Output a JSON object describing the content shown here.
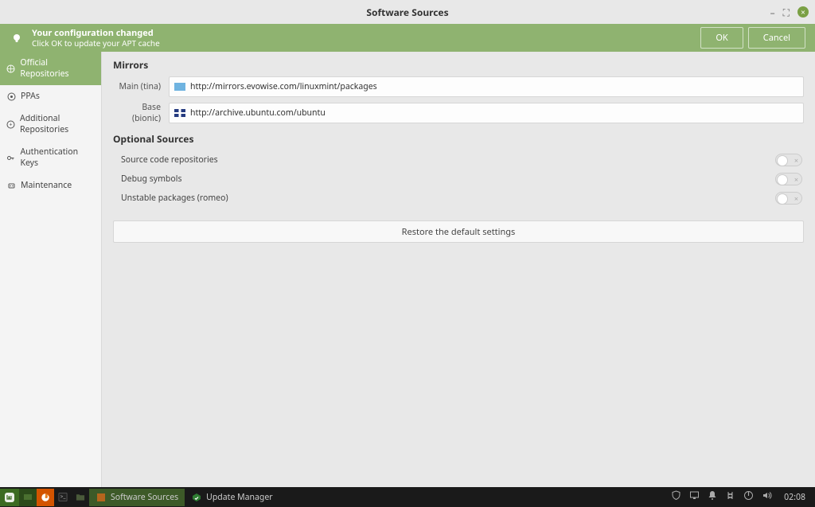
{
  "window": {
    "title": "Software Sources"
  },
  "banner": {
    "line1": "Your configuration changed",
    "line2": "Click OK to update your APT cache",
    "ok": "OK",
    "cancel": "Cancel"
  },
  "sidebar": {
    "items": [
      {
        "label": "Official Repositories"
      },
      {
        "label": "PPAs"
      },
      {
        "label": "Additional Repositories"
      },
      {
        "label": "Authentication Keys"
      },
      {
        "label": "Maintenance"
      }
    ]
  },
  "content": {
    "mirrors_heading": "Mirrors",
    "main_label": "Main (tina)",
    "main_url": "http://mirrors.evowise.com/linuxmint/packages",
    "base_label": "Base (bionic)",
    "base_url": "http://archive.ubuntu.com/ubuntu",
    "optional_heading": "Optional Sources",
    "opt1": "Source code repositories",
    "opt2": "Debug symbols",
    "opt3": "Unstable packages (romeo)",
    "restore": "Restore the default settings"
  },
  "taskbar": {
    "apps": [
      {
        "label": "Software Sources"
      },
      {
        "label": "Update Manager"
      }
    ],
    "clock": "02:08"
  }
}
